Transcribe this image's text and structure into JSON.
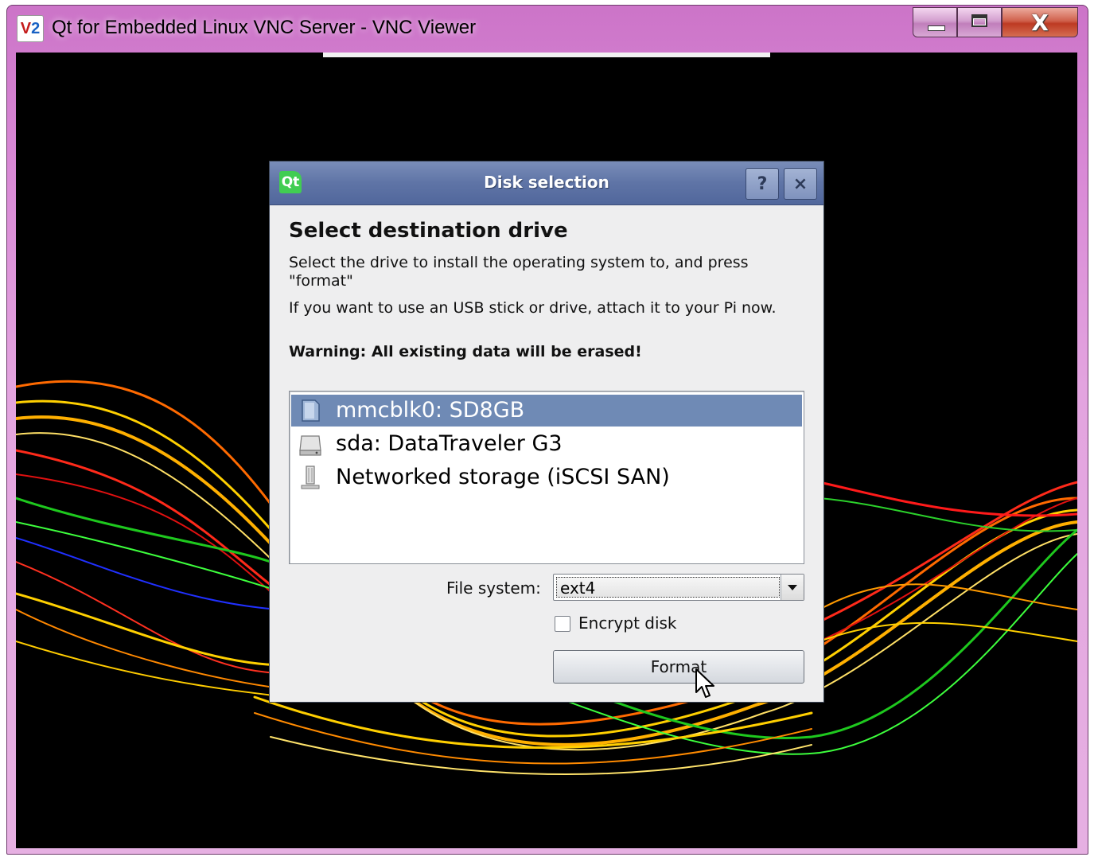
{
  "window": {
    "title": "Qt for Embedded Linux VNC Server - VNC Viewer",
    "logo_text": "V",
    "logo_text2": "2",
    "close_glyph": "X"
  },
  "dialog": {
    "app_icon_text": "Qt",
    "title": "Disk selection",
    "help_glyph": "?",
    "close_glyph": "×",
    "heading": "Select destination drive",
    "paragraph1": "Select the drive to install the operating system to, and press \"format\"",
    "paragraph2": "If you want to use an USB stick or drive, attach it to your Pi now.",
    "warning": "Warning: All existing data will be erased!",
    "drives": [
      {
        "label": "mmcblk0: SD8GB",
        "icon": "sd-card-icon",
        "selected": true
      },
      {
        "label": "sda: DataTraveler G3",
        "icon": "hard-drive-icon",
        "selected": false
      },
      {
        "label": "Networked storage (iSCSI SAN)",
        "icon": "network-storage-icon",
        "selected": false
      }
    ],
    "filesystem_label": "File system:",
    "filesystem_value": "ext4",
    "encrypt_label": "Encrypt disk",
    "encrypt_checked": false,
    "format_button": "Format"
  },
  "colors": {
    "title_bar": "#5f74a6",
    "selection": "#6f8ab5",
    "window_frame": "#d98ad6"
  }
}
